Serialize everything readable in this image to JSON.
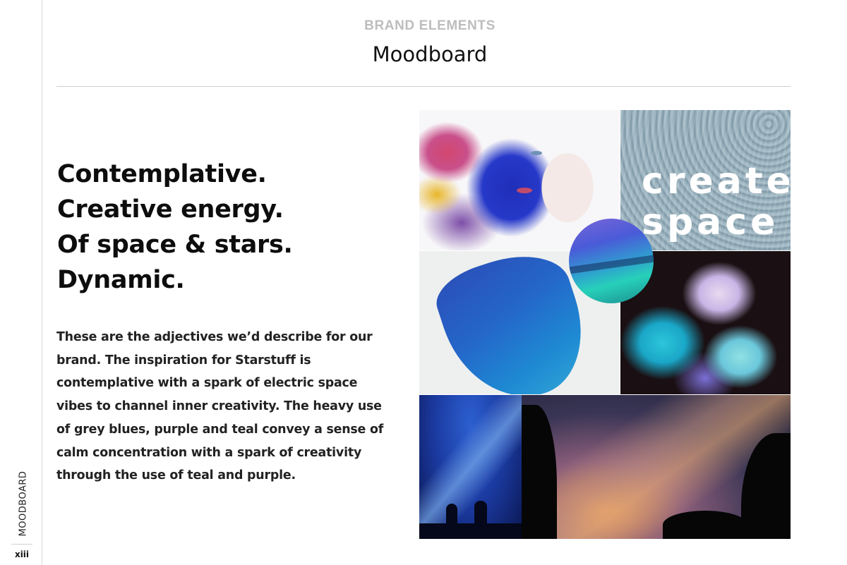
{
  "header": {
    "kicker": "BRAND ELEMENTS",
    "title": "Moodboard"
  },
  "sidebar": {
    "section_label": "MOODBOARD",
    "page_number": "xiii"
  },
  "main": {
    "headline_lines": [
      "Contemplative.",
      "Creative energy.",
      "Of space & stars.",
      "Dynamic."
    ],
    "body": "These are the adjectives we’d describe for our brand. The inspiration for Starstuff is contemplative with a spark of electric space vibes to channel inner creativity. The heavy use of grey blues, purple and teal convey a sense of calm concentration with a spark of creativity through the use of teal and purple."
  },
  "moodboard": {
    "overlay_text_line1": "create",
    "overlay_text_line2": "space",
    "tiles": [
      "watercolor-face-image",
      "swirl-texture-image",
      "blue-paint-stroke-image",
      "teal-purple-paint-circle-image",
      "colored-smoke-image",
      "starry-sky-silhouettes-image",
      "milky-way-image"
    ]
  }
}
